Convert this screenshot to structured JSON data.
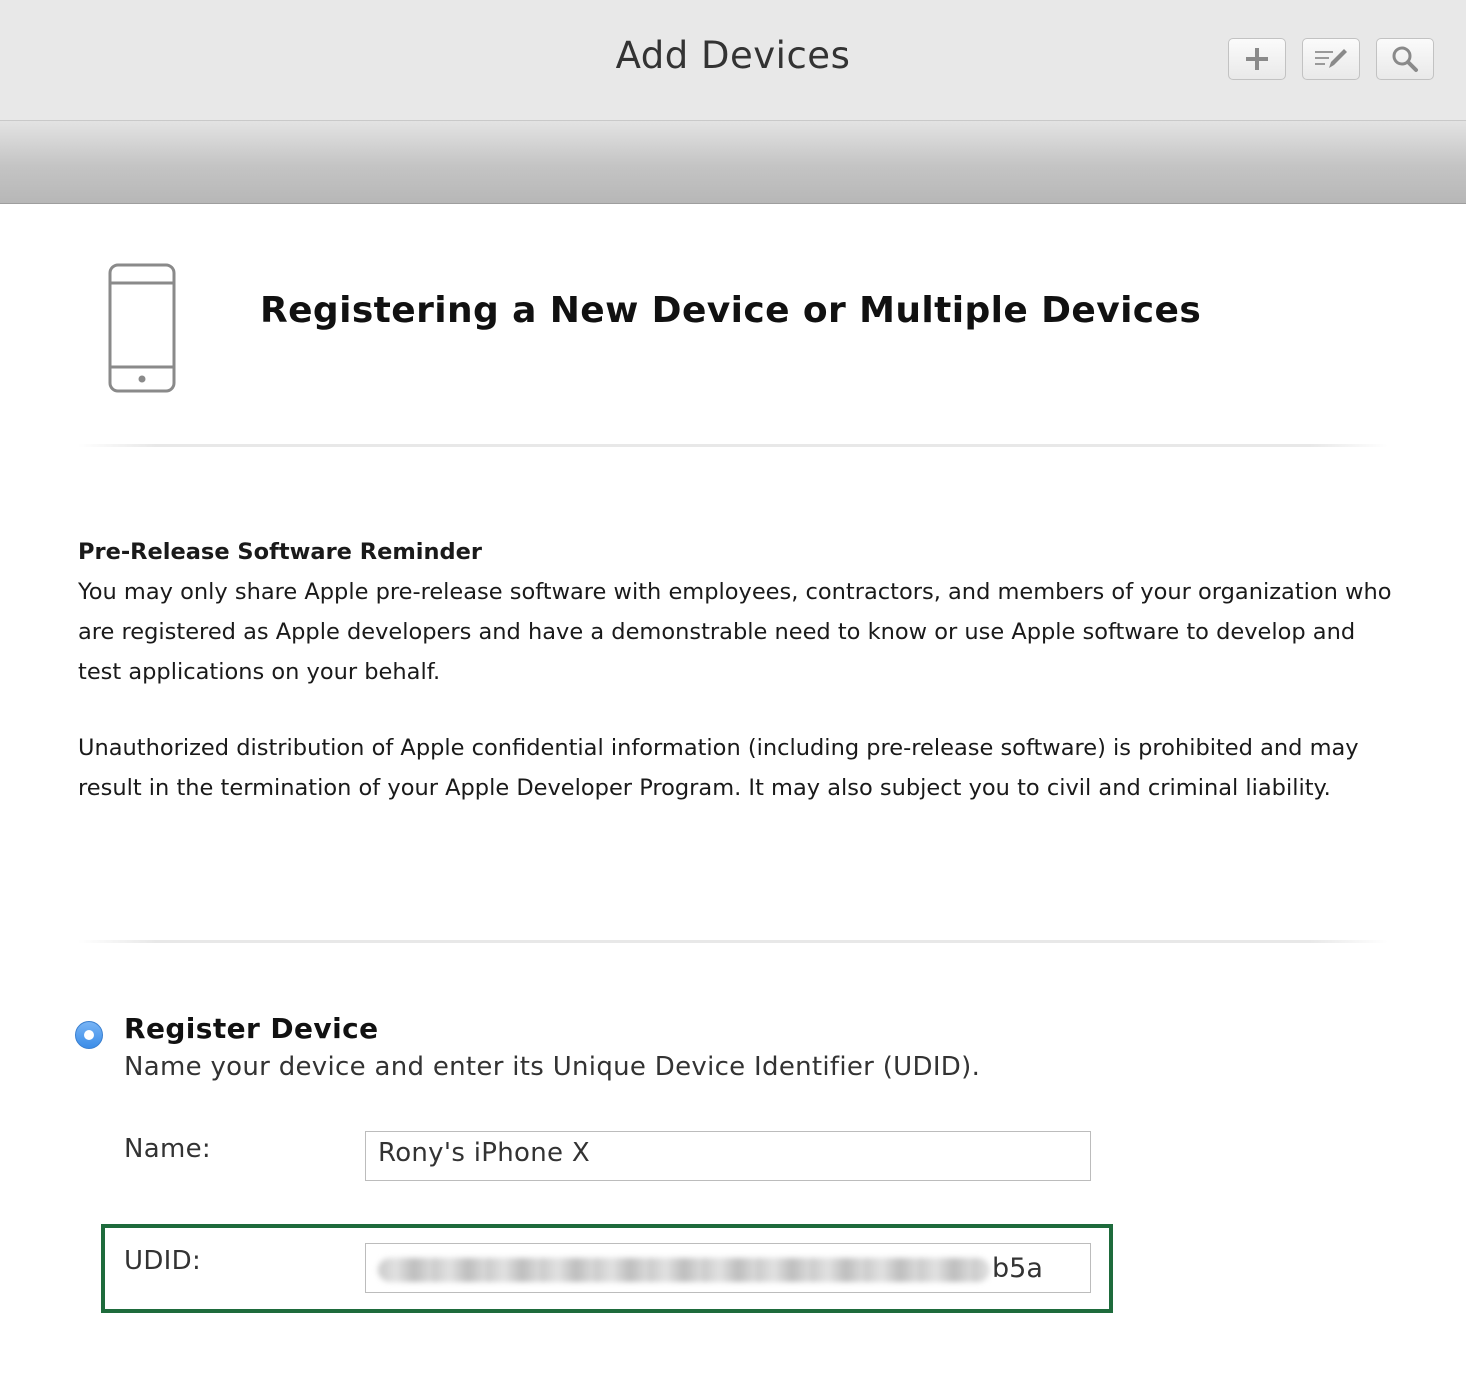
{
  "header": {
    "title": "Add Devices",
    "toolbar": [
      "plus-icon",
      "edit-icon",
      "search-icon"
    ]
  },
  "page": {
    "title": "Registering a New Device or Multiple Devices",
    "icon": "iphone-icon"
  },
  "notice": {
    "title": "Pre-Release Software Reminder",
    "paragraph1": "You may only share Apple pre-release software with employees, contractors, and members of your organization who are registered as Apple developers and have a demonstrable need to know or use Apple software to develop and test applications on your behalf.",
    "paragraph2": "Unauthorized distribution of Apple confidential information (including pre-release software) is prohibited and may result in the termination of your Apple Developer Program. It may also subject you to civil and criminal liability."
  },
  "register": {
    "selected": true,
    "title": "Register Device",
    "description": "Name your device and enter its Unique Device Identifier (UDID).",
    "name_label": "Name:",
    "name_value": "Rony's iPhone X",
    "udid_label": "UDID:",
    "udid_visible_suffix": "b5a"
  },
  "colors": {
    "highlight_border": "#1e6b3c",
    "radio_selected": "#3b8de8"
  }
}
